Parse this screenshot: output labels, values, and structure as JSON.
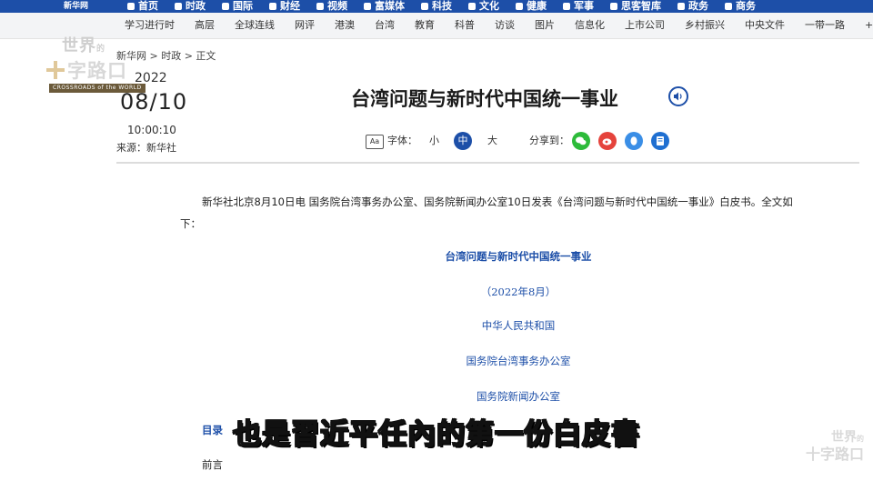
{
  "topnav": {
    "brand": "新华网",
    "items": [
      "首页",
      "时政",
      "国际",
      "财经",
      "视频",
      "富媒体",
      "科技",
      "文化",
      "健康",
      "军事",
      "思客智库",
      "政务",
      "商务"
    ]
  },
  "subnav": [
    "学习进行时",
    "高层",
    "全球连线",
    "网评",
    "港澳",
    "台湾",
    "教育",
    "科普",
    "访谈",
    "图片",
    "信息化",
    "上市公司",
    "乡村振兴",
    "中央文件",
    "一带一路",
    "+"
  ],
  "watermark_logo": {
    "line1": "世界",
    "line1_small": "的",
    "line2": "字路口",
    "band": "CROSSROADS of the WORLD"
  },
  "breadcrumb": "新华网 > 时政 > 正文",
  "meta": {
    "year": "2022",
    "month_day": "08/10",
    "time": "10:00:10",
    "source": "来源：新华社"
  },
  "article": {
    "title": "台湾问题与新时代中国统一事业",
    "font_label": "字体：",
    "size_small": "小",
    "size_medium": "中",
    "size_large": "大",
    "share_label": "分享到：",
    "lead": "新华社北京8月10日电 国务院台湾事务办公室、国务院新闻办公室10日发表《台湾问题与新时代中国统一事业》白皮书。全文如下：",
    "doc_title": "台湾问题与新时代中国统一事业",
    "doc_date": "（2022年8月）",
    "issuer1": "中华人民共和国",
    "issuer2": "国务院台湾事务办公室",
    "issuer3": "国务院新闻办公室",
    "toc_label": "目录",
    "preface_label": "前言"
  },
  "subtitle": "也是習近平任內的第一份白皮書",
  "watermark_corner": {
    "line1": "世界",
    "line1_small": "的",
    "line2": "十字路口"
  },
  "colors": {
    "nav": "#1d4fa8",
    "accent": "#1d4fa8",
    "wechat": "#2dbb3a",
    "weibo": "#e5433c",
    "qq": "#3a8ee6",
    "note": "#1f6fd1"
  }
}
